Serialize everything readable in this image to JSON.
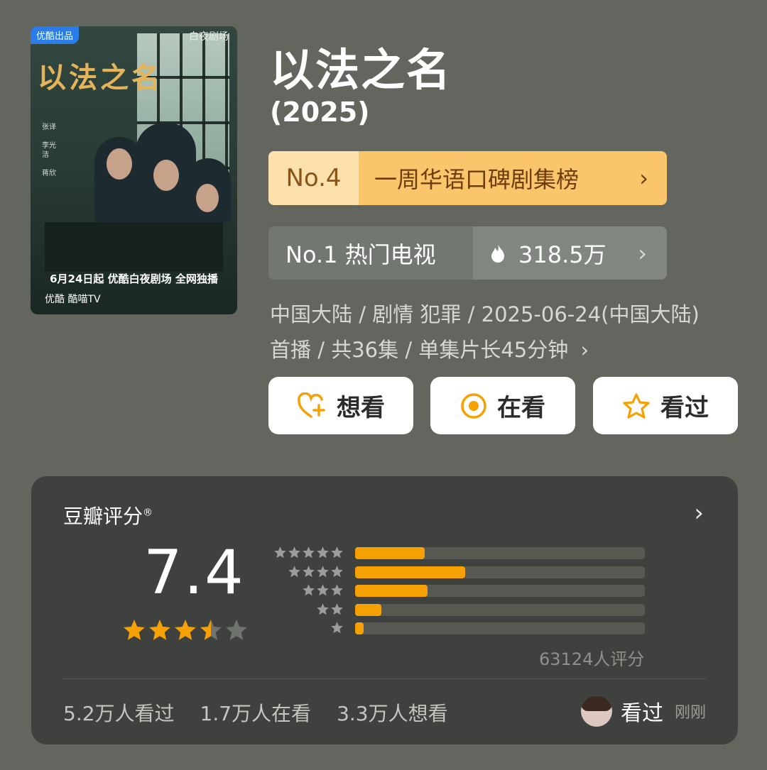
{
  "poster": {
    "badge": "优酷出品",
    "brand": "白夜剧场",
    "title_art": "以法之名",
    "cast": [
      "张译",
      "李光洁",
      "蒋欣"
    ],
    "release_line": "6月24日起 优酷白夜剧场 全网独播",
    "platform_line": "优酷  酷喵TV"
  },
  "header": {
    "title": "以法之名",
    "year": "(2025)"
  },
  "rankings": [
    {
      "rank": "No.4",
      "label": "一周华语口碑剧集榜"
    },
    {
      "rank_label": "No.1 热门电视",
      "heat": "318.5万"
    }
  ],
  "meta": {
    "line1": "中国大陆 / 剧情 犯罪 / 2025-06-24(中国大陆)",
    "line2": "首播 / 共36集 / 单集片长45分钟"
  },
  "actions": {
    "want": "想看",
    "watching": "在看",
    "watched": "看过"
  },
  "rating": {
    "label": "豆瓣评分",
    "score": "7.4",
    "stars": 3.5,
    "distribution": [
      {
        "stars": 5,
        "fraction": 0.24
      },
      {
        "stars": 4,
        "fraction": 0.38
      },
      {
        "stars": 3,
        "fraction": 0.25
      },
      {
        "stars": 2,
        "fraction": 0.09
      },
      {
        "stars": 1,
        "fraction": 0.03
      }
    ],
    "count": "63124人评分"
  },
  "stats": {
    "watched": "5.2万人看过",
    "watching": "1.7万人在看",
    "want": "3.3万人想看"
  },
  "recent": {
    "action": "看过",
    "when": "刚刚"
  },
  "colors": {
    "background": "#62665f",
    "rank_gold": "#fbc56b",
    "star_orange": "#f5a003",
    "card": "#3e413d"
  }
}
